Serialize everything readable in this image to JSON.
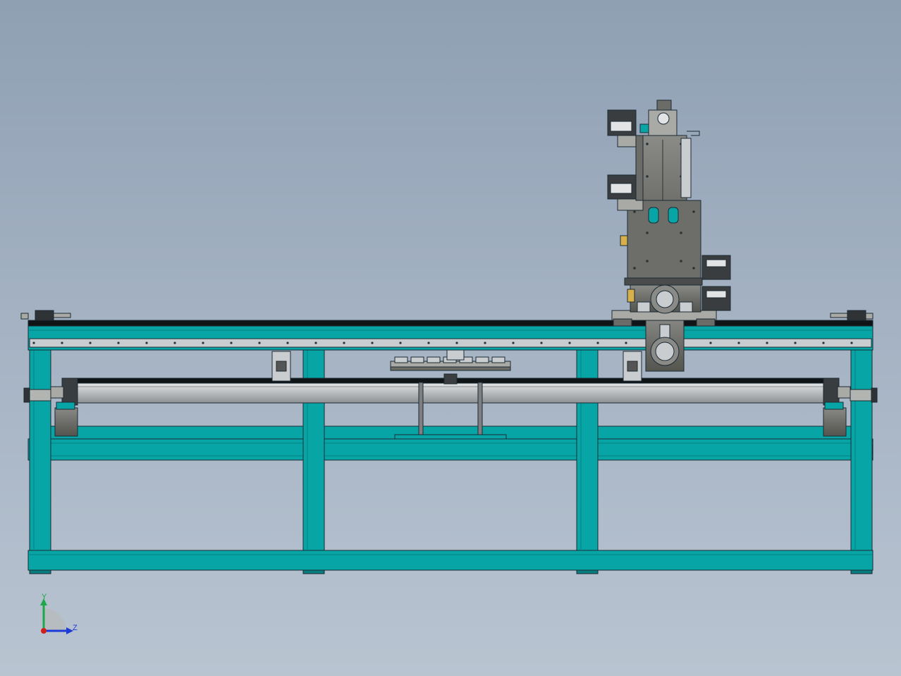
{
  "viewport": {
    "background_top": "#8fa0b3",
    "background_bottom": "#b9c4d1"
  },
  "colors": {
    "frame": "#08a5a6",
    "frame_dark": "#067e80",
    "outline": "#1b2a33",
    "steel": "#6b6b68",
    "steel_light": "#a9aaa6",
    "rail": "#c9cdd0",
    "belt": "#111417",
    "accent_yellow": "#d8b04a"
  },
  "triad": {
    "y_label": "Y",
    "z_label": "Z",
    "y_color": "#1ea84a",
    "z_color": "#1c3ad6",
    "x_color": "#d21d1d"
  },
  "parts": [
    {
      "name": "base-frame",
      "label": "frame"
    },
    {
      "name": "top-beam",
      "label": "beam"
    },
    {
      "name": "linear-guide-belt",
      "label": "belt"
    },
    {
      "name": "ball-screw",
      "label": "screw"
    },
    {
      "name": "vertical-axis-assembly",
      "label": "z-axis"
    },
    {
      "name": "gripper-carriage",
      "label": "carriage"
    }
  ]
}
